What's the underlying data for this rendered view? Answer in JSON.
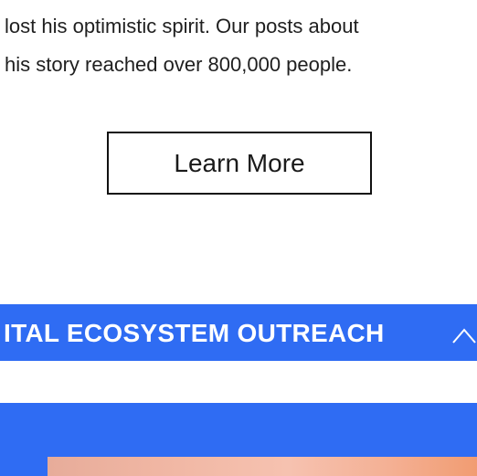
{
  "story": {
    "lines": [
      "lost his optimistic spirit. Our posts about",
      "his story reached over 800,000 people."
    ]
  },
  "cta": {
    "label": "Learn More"
  },
  "section": {
    "title": "ITAL ECOSYSTEM OUTREACH",
    "toggle_icon": "chevron-up-icon"
  },
  "colors": {
    "accent": "#2f6cf3",
    "text": "#1f1f1f"
  }
}
